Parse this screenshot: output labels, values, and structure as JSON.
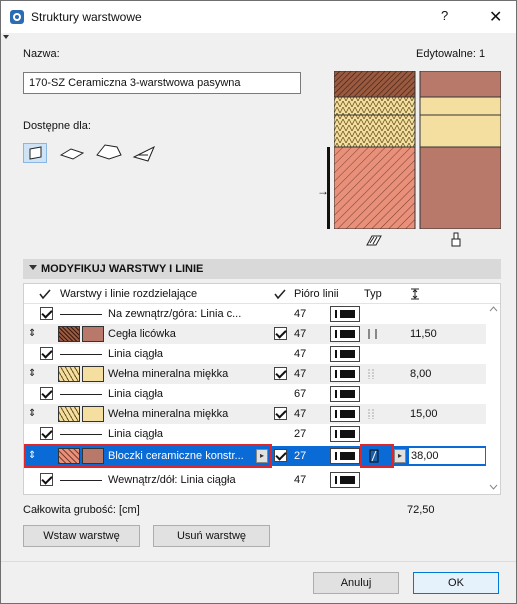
{
  "window": {
    "title": "Struktury warstwowe",
    "help": "?",
    "close": "✕"
  },
  "name_label": "Nazwa:",
  "editable_label": "Edytowalne: 1",
  "name_value": "170-SZ Ceramiczna 3-warstwowa pasywna",
  "available_label": "Dostępne dla:",
  "section_title": "MODYFIKUJ WARSTWY I LINIE",
  "columns": {
    "layers": "Warstwy i linie rozdzielające",
    "pen": "Pióro linii",
    "type": "Typ"
  },
  "rows": [
    {
      "kind": "line",
      "label": "Na zewnątrz/góra: Linia c...",
      "pen": "47"
    },
    {
      "kind": "layer",
      "label": "Cegła licówka",
      "pen": "47",
      "value": "11,50"
    },
    {
      "kind": "line",
      "label": "Linia ciągła",
      "pen": "47"
    },
    {
      "kind": "layer",
      "label": "Wełna mineralna miękka",
      "pen": "47",
      "value": "8,00"
    },
    {
      "kind": "line",
      "label": "Linia ciągła",
      "pen": "67"
    },
    {
      "kind": "layer",
      "label": "Wełna mineralna miękka",
      "pen": "47",
      "value": "15,00"
    },
    {
      "kind": "line",
      "label": "Linia ciągła",
      "pen": "27"
    },
    {
      "kind": "layer",
      "label": "Bloczki ceramiczne konstr...",
      "pen": "27",
      "value": "38,00",
      "selected": true
    },
    {
      "kind": "line",
      "label": "Wewnątrz/dół: Linia ciągła",
      "pen": "47"
    }
  ],
  "total_label": "Całkowita grubość: [cm]",
  "total_value": "72,50",
  "buttons": {
    "insert": "Wstaw warstwę",
    "remove": "Usuń warstwę",
    "cancel": "Anuluj",
    "ok": "OK"
  },
  "colors": {
    "brick": "#e8907a",
    "brick_solid": "#b8786a",
    "wool": "#f5dfa0",
    "highlight": "#e0262b",
    "selection": "#0a6ad6"
  }
}
